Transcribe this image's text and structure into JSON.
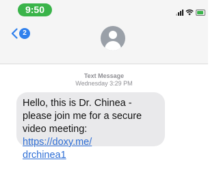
{
  "status_bar": {
    "time": "9:50",
    "time_pill_color": "#3ab44a",
    "battery_color": "#3ab44a",
    "icons": [
      "signal-icon",
      "wifi-icon",
      "battery-icon"
    ]
  },
  "header": {
    "back_badge_count": "2",
    "badge_color": "#2f80ed",
    "avatar_icon": "person-silhouette-icon"
  },
  "thread": {
    "service_label": "Text Message",
    "timestamp": "Wednesday 3:29 PM"
  },
  "message": {
    "text_before_link": "Hello, this is Dr. Chinea - please join me for a secure video meeting: ",
    "link_line1": "https://doxy.me/",
    "link_line2": "drchinea1",
    "link_color": "#2f6fd6",
    "bubble_color": "#e9e9eb"
  }
}
